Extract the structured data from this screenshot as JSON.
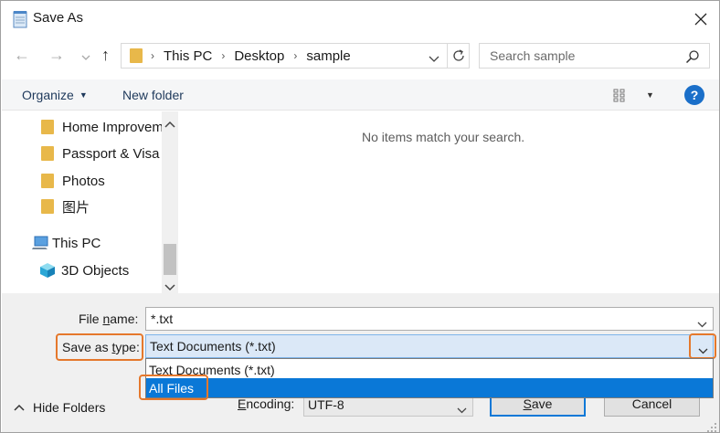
{
  "window": {
    "title": "Save As"
  },
  "nav": {
    "breadcrumbs": [
      "This PC",
      "Desktop",
      "sample"
    ],
    "search_placeholder": "Search sample"
  },
  "toolbar": {
    "organize_label": "Organize",
    "new_folder_label": "New folder",
    "help_label": "?"
  },
  "navpane": {
    "items": [
      {
        "label": "Home Improvem"
      },
      {
        "label": "Passport & Visa"
      },
      {
        "label": "Photos"
      },
      {
        "label": "图片"
      },
      {
        "label": "This PC"
      },
      {
        "label": "3D Objects"
      }
    ]
  },
  "content": {
    "empty_message": "No items match your search."
  },
  "form": {
    "filename_label_pre": "File ",
    "filename_label_u": "n",
    "filename_label_post": "ame:",
    "filename_value": "*.txt",
    "savetype_label_pre": "Save as ",
    "savetype_label_u": "t",
    "savetype_label_post": "ype:",
    "savetype_value": "Text Documents (*.txt)",
    "savetype_options": [
      "Text Documents (*.txt)",
      "All Files"
    ],
    "encoding_label_pre": "",
    "encoding_label_u": "E",
    "encoding_label_post": "ncoding:",
    "encoding_value": "UTF-8"
  },
  "footer": {
    "hide_folders_label": "Hide Folders",
    "save_label_u": "S",
    "save_label_post": "ave",
    "cancel_label": "Cancel"
  },
  "colors": {
    "highlight": "#e5782c",
    "selection": "#0a78d7",
    "help": "#1a6fc9",
    "folder": "#e8b84a"
  },
  "icons": [
    "notepad-icon",
    "close-icon",
    "back-arrow-icon",
    "forward-arrow-icon",
    "recent-chevron-icon",
    "up-arrow-icon",
    "folder-icon",
    "chevron-down-icon",
    "refresh-icon",
    "search-icon",
    "view-options-icon",
    "help-icon",
    "pc-icon",
    "3d-objects-icon",
    "scroll-up-icon",
    "scroll-down-icon",
    "chevron-up-icon"
  ]
}
